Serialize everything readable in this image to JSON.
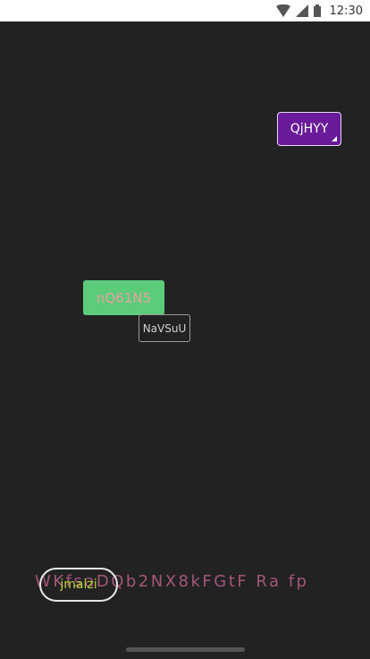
{
  "status_bar": {
    "time": "12:30",
    "icons": [
      "wifi-icon",
      "cellular-signal-icon",
      "battery-icon"
    ]
  },
  "dropdown_button": {
    "label": "QjHYY",
    "color": "#6a1b9a"
  },
  "green_button": {
    "label": "nQ61N5",
    "color": "#5ccc7a",
    "text_color": "#e8a0a0"
  },
  "outlined_button": {
    "label": "NaVSuU"
  },
  "long_text": {
    "text": "WKfsaDQb2NX8kFGtF Ra fp",
    "color": "#a3567a"
  },
  "pill_button": {
    "label": "jmalzi",
    "text_color": "#b8d430"
  },
  "background_color": "#222222"
}
